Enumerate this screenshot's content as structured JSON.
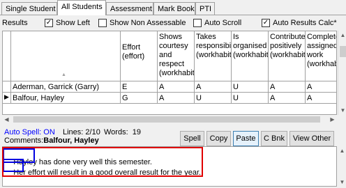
{
  "tabs": [
    "Single Student",
    "All Students",
    "Assessment",
    "Mark Book",
    "PTI"
  ],
  "active_tab": "All Students",
  "options": {
    "results_label": "Results",
    "show_left": {
      "label": "Show Left",
      "checked": true
    },
    "show_non_assessable": {
      "label": "Show Non Assessable",
      "checked": false
    },
    "auto_scroll": {
      "label": "Auto Scroll",
      "checked": false
    },
    "auto_results_calc": {
      "label": "Auto Results Calc*",
      "checked": true
    },
    "check_mark": "✓"
  },
  "grid": {
    "columns": [
      "",
      "Effort (effort)",
      "Shows courtesy and respect (workhabits)",
      "Takes responsibility (workhabits)",
      "Is organised (workhabits)",
      "Contributes positively (workhabits)",
      "Completes assigned work (workhabits)"
    ],
    "sort_indicator": "▲",
    "current_row_marker": "▶",
    "rows": [
      {
        "name": "Aderman, Garrick (Garry)",
        "values": [
          "E",
          "A",
          "A",
          "U",
          "A",
          "A"
        ]
      },
      {
        "name": "Balfour, Hayley",
        "values": [
          "G",
          "A",
          "U",
          "U",
          "A",
          "A"
        ]
      }
    ]
  },
  "info": {
    "auto_spell": "Auto Spell: ON",
    "lines": "Lines: 2/10",
    "words": "Words:  19",
    "comments_label": "Comments:",
    "comments_student": "Balfour, Hayley"
  },
  "buttons": {
    "spell": "Spell",
    "copy": "Copy",
    "paste": "Paste",
    "cbnk": "C Bnk",
    "view_other": "View Other"
  },
  "comment": {
    "line1_highlight": "Hayley",
    "line1_rest": " has done very well this semester.",
    "line2_highlight": "Her",
    "line2_rest": " effort will result in a good overall result for the year."
  },
  "colors": {
    "highlight_red": "#e00000",
    "highlight_blue": "#0000e0",
    "link_blue": "#0000ff"
  },
  "scroll_arrows": {
    "up": "▲",
    "down": "▼",
    "left": "◀",
    "right": "▶"
  }
}
